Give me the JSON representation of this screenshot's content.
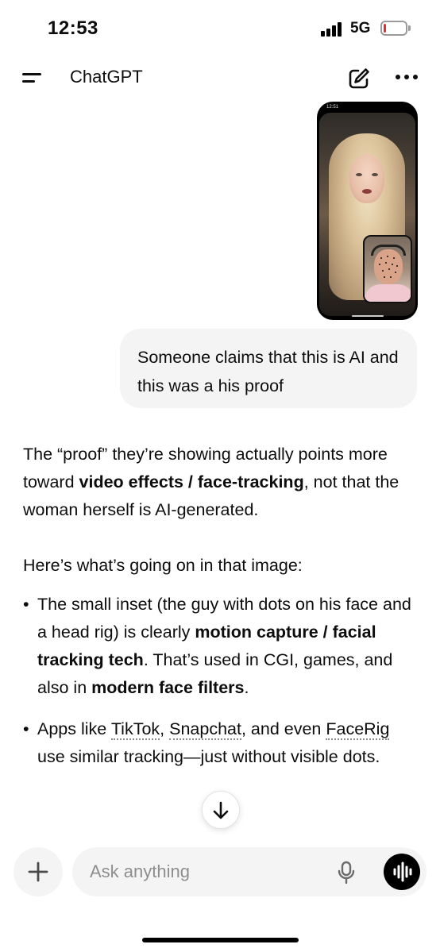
{
  "status_bar": {
    "time": "12:53",
    "network": "5G",
    "battery_level": 0.1,
    "battery_color": "#e52d2d"
  },
  "header": {
    "title": "ChatGPT",
    "menu_icon": "hamburger-menu-icon",
    "compose_icon": "new-chat-pencil-icon",
    "more_icon": "more-dots-icon"
  },
  "attachment": {
    "phone_time": "12:51"
  },
  "user_message": {
    "text": "Someone claims that this is AI and this was a his proof"
  },
  "assistant_message": {
    "p1_a": "The “proof” they’re showing actually points more toward ",
    "p1_b": "video effects / face-tracking",
    "p1_c": ", not that the woman herself is AI-generated.",
    "p2": "Here’s what’s going on in that image:",
    "b1_a": "The small inset (the guy with dots on his face and a head rig) is clearly ",
    "b1_b": "motion capture / facial tracking tech",
    "b1_c": ". That’s used in CGI, games, and also in ",
    "b1_d": "modern face filters",
    "b1_e": ".",
    "b2_a": "Apps like ",
    "b2_link1": "TikTok",
    "b2_sep": ", ",
    "b2_link2": "Snapchat",
    "b2_b": ", and even ",
    "b2_link3": "FaceRig",
    "b2_c": " use similar tracking—just without visible dots."
  },
  "scroll_button": {
    "icon": "arrow-down-icon"
  },
  "composer": {
    "placeholder": "Ask anything",
    "plus_icon": "plus-icon",
    "mic_icon": "microphone-icon",
    "voice_icon": "voice-mode-icon"
  }
}
